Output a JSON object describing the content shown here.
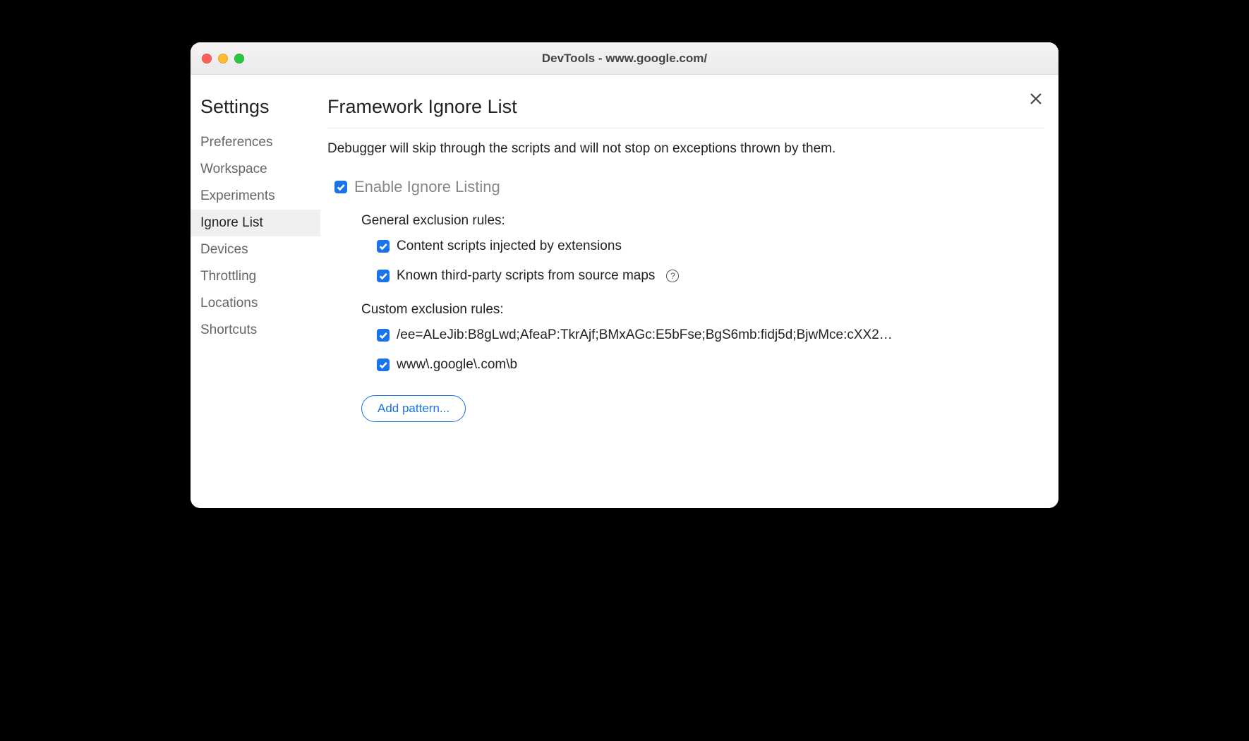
{
  "window": {
    "title": "DevTools - www.google.com/"
  },
  "sidebar": {
    "title": "Settings",
    "items": [
      {
        "label": "Preferences",
        "active": false
      },
      {
        "label": "Workspace",
        "active": false
      },
      {
        "label": "Experiments",
        "active": false
      },
      {
        "label": "Ignore List",
        "active": true
      },
      {
        "label": "Devices",
        "active": false
      },
      {
        "label": "Throttling",
        "active": false
      },
      {
        "label": "Locations",
        "active": false
      },
      {
        "label": "Shortcuts",
        "active": false
      }
    ]
  },
  "main": {
    "title": "Framework Ignore List",
    "description": "Debugger will skip through the scripts and will not stop on exceptions thrown by them.",
    "enable_label": "Enable Ignore Listing",
    "enable_checked": true,
    "general_section_label": "General exclusion rules:",
    "general_rules": [
      {
        "label": "Content scripts injected by extensions",
        "checked": true,
        "help": false
      },
      {
        "label": "Known third-party scripts from source maps",
        "checked": true,
        "help": true
      }
    ],
    "custom_section_label": "Custom exclusion rules:",
    "custom_rules": [
      {
        "label": "/ee=ALeJib:B8gLwd;AfeaP:TkrAjf;BMxAGc:E5bFse;BgS6mb:fidj5d;BjwMce:cXX2…",
        "checked": true
      },
      {
        "label": "www\\.google\\.com\\b",
        "checked": true
      }
    ],
    "add_pattern_label": "Add pattern..."
  }
}
